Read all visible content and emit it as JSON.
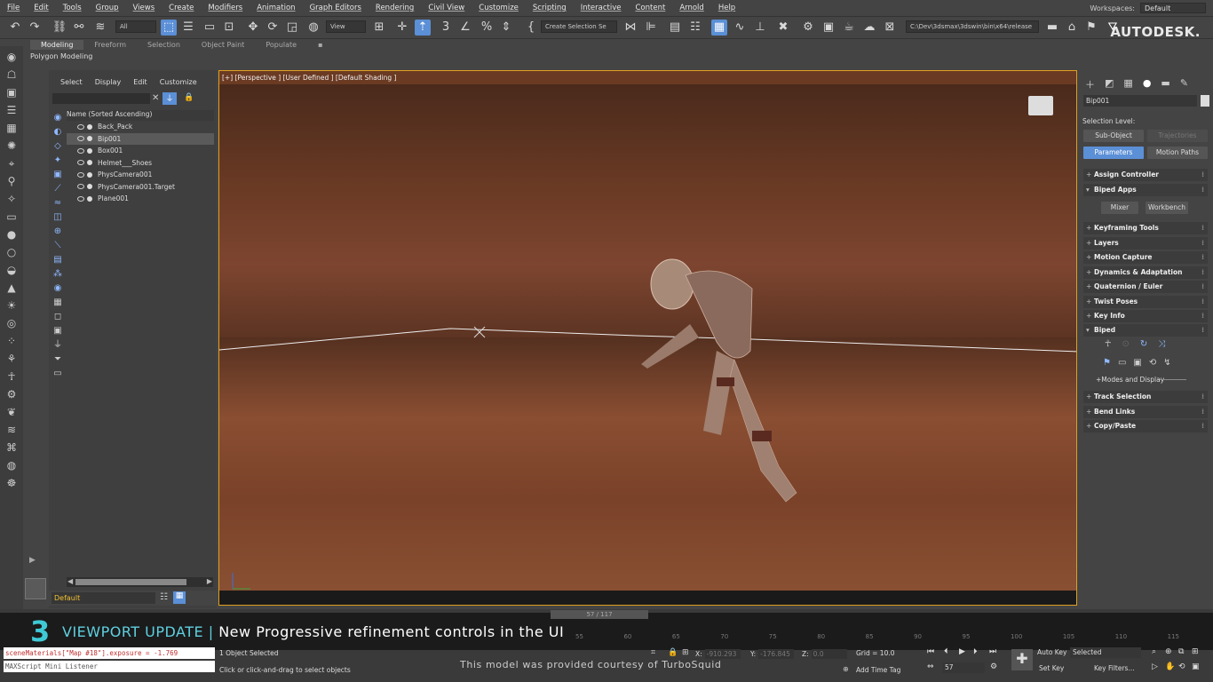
{
  "menu": [
    "File",
    "Edit",
    "Tools",
    "Group",
    "Views",
    "Create",
    "Modifiers",
    "Animation",
    "Graph Editors",
    "Rendering",
    "Civil View",
    "Customize",
    "Scripting",
    "Interactive",
    "Content",
    "Arnold",
    "Help"
  ],
  "workspaces": {
    "label": "Workspaces:",
    "value": "Default"
  },
  "toolbar": {
    "filter_all": "All",
    "ref_coord": "View",
    "selection_set": "Create Selection Se",
    "path": "C:\\Dev\\3dsmax\\3dswin\\bin\\x64\\release",
    "brand": "AUTODESK."
  },
  "ribbon": {
    "tabs": [
      "Modeling",
      "Freeform",
      "Selection",
      "Object Paint",
      "Populate"
    ],
    "active_tab": "Modeling",
    "sub": "Polygon Modeling"
  },
  "explorer": {
    "menu": [
      "Select",
      "Display",
      "Edit",
      "Customize"
    ],
    "header": "Name (Sorted Ascending)",
    "items": [
      {
        "name": "Back_Pack",
        "selected": false
      },
      {
        "name": "Bip001",
        "selected": true
      },
      {
        "name": "Box001",
        "selected": false
      },
      {
        "name": "Helmet___Shoes",
        "selected": false
      },
      {
        "name": "PhysCamera001",
        "selected": false
      },
      {
        "name": "PhysCamera001.Target",
        "selected": false
      },
      {
        "name": "Plane001",
        "selected": false
      }
    ],
    "layer": "Default"
  },
  "viewport": {
    "label": "[+] [Perspective ] [User Defined ] [Default Shading ]"
  },
  "cmdpanel": {
    "object_name": "Bip001",
    "selection_level": "Selection Level:",
    "sub_object": "Sub-Object",
    "trajectories": "Trajectories",
    "parameters": "Parameters",
    "motion_paths": "Motion Paths",
    "rollouts": [
      {
        "label": "Assign Controller",
        "open": false
      },
      {
        "label": "Biped Apps",
        "open": true
      }
    ],
    "mixer": "Mixer",
    "workbench": "Workbench",
    "rollouts2": [
      "Keyframing Tools",
      "Layers",
      "Motion Capture",
      "Dynamics & Adaptation",
      "Quaternion / Euler",
      "Twist Poses",
      "Key Info"
    ],
    "biped": "Biped",
    "modes_display": "+Modes and Display",
    "rollouts3": [
      "Track Selection",
      "Bend Links",
      "Copy/Paste"
    ]
  },
  "banner": {
    "num": "3",
    "title": "VIEWPORT UPDATE |",
    "subtitle": "New Progressive refinement controls in the UI"
  },
  "timeline": {
    "frame": "57 / 117",
    "ticks": [
      "55",
      "60",
      "65",
      "70",
      "75",
      "80",
      "85",
      "90",
      "95",
      "100",
      "105",
      "110",
      "115"
    ]
  },
  "maxscript": {
    "line1": "sceneMaterials[\"Map #18\"].exposure = -1.769",
    "line2": "MAXScript Mini Listener"
  },
  "status": {
    "selected": "1 Object Selected",
    "hint": "Click or click-and-drag to select objects",
    "credit": "This model was provided courtesy of TurboSquid",
    "x_label": "X:",
    "x_val": "-910.293",
    "y_label": "Y:",
    "y_val": "-176.845",
    "z_label": "Z:",
    "z_val": "0.0",
    "grid": "Grid = 10.0",
    "add_time_tag": "Add Time Tag"
  },
  "anim": {
    "auto_key": "Auto Key",
    "set_key": "Set Key",
    "selected": "Selected",
    "key_filters": "Key Filters...",
    "frame": "57"
  }
}
